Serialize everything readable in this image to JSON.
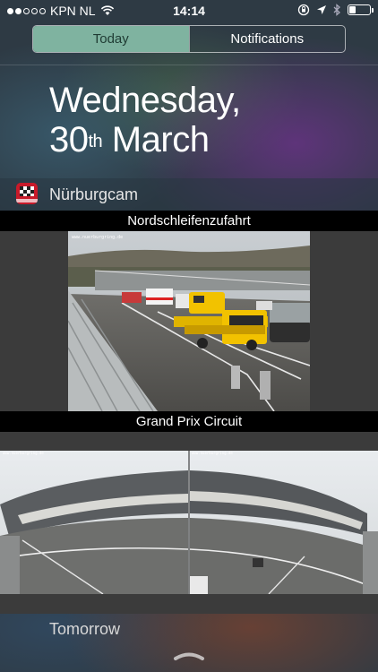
{
  "status_bar": {
    "carrier": "KPN NL",
    "time": "14:14",
    "signal_dots_filled": 2,
    "signal_dots_total": 5,
    "battery_level": 0.3
  },
  "segmented": {
    "today_label": "Today",
    "notifications_label": "Notifications",
    "selected": "Today"
  },
  "date": {
    "line1": "Wednesday,",
    "day_number": "30",
    "ordinal": "th",
    "month": " March"
  },
  "widget": {
    "app_name": "Nürburgcam",
    "cams": [
      {
        "label": "Nordschleifenzufahrt"
      },
      {
        "label": "Grand Prix Circuit"
      }
    ]
  },
  "tomorrow_label": "Tomorrow",
  "icons": [
    "wifi-icon",
    "lock-rotation-icon",
    "location-arrow-icon",
    "bluetooth-icon",
    "battery-icon",
    "app-icon",
    "grabber-icon"
  ],
  "colors": {
    "segment_active": "#7fb3a0",
    "app_icon_red": "#c81a2a",
    "truck_yellow": "#f2c200"
  }
}
